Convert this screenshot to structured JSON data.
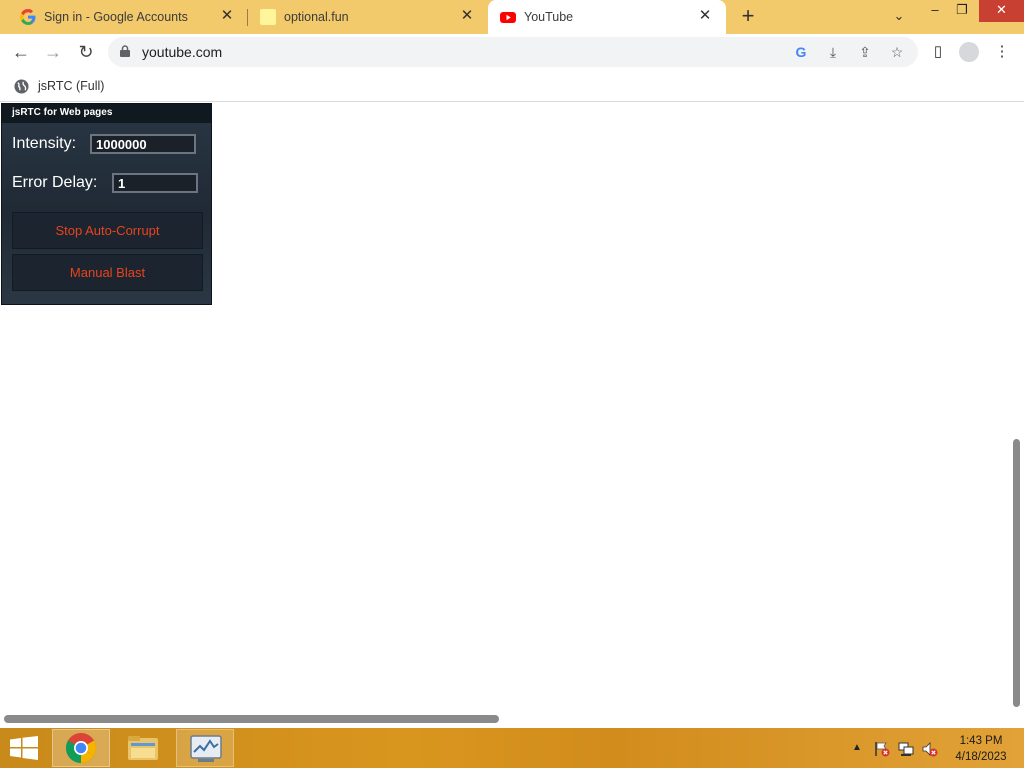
{
  "browser": {
    "tabs": [
      {
        "title": "Sign in - Google Accounts",
        "favicon": "google-g-icon"
      },
      {
        "title": "optional.fun",
        "favicon": "yellow-page-icon"
      },
      {
        "title": "YouTube",
        "favicon": "youtube-icon",
        "active": true
      }
    ],
    "new_tab_label": "+",
    "url": "youtube.com",
    "bookmarks": [
      {
        "label": "jsRTC (Full)",
        "icon": "globe-icon"
      }
    ]
  },
  "rtc_panel": {
    "header": "jsRTC for Web pages",
    "intensity_label": "Intensity:",
    "intensity_value": "1000000",
    "error_delay_label": "Error Delay:",
    "error_delay_value": "1",
    "stop_button": "Stop Auto-Corrupt",
    "blast_button": "Manual Blast",
    "accent_color": "#e8421f"
  },
  "taskbar": {
    "apps": [
      "chrome",
      "file-explorer",
      "resource-monitor"
    ],
    "time": "1:43 PM",
    "date": "4/18/2023"
  },
  "colors": {
    "tabstrip": "#f2c96b",
    "taskbar": "#d9961e",
    "close_button": "#c84031"
  }
}
